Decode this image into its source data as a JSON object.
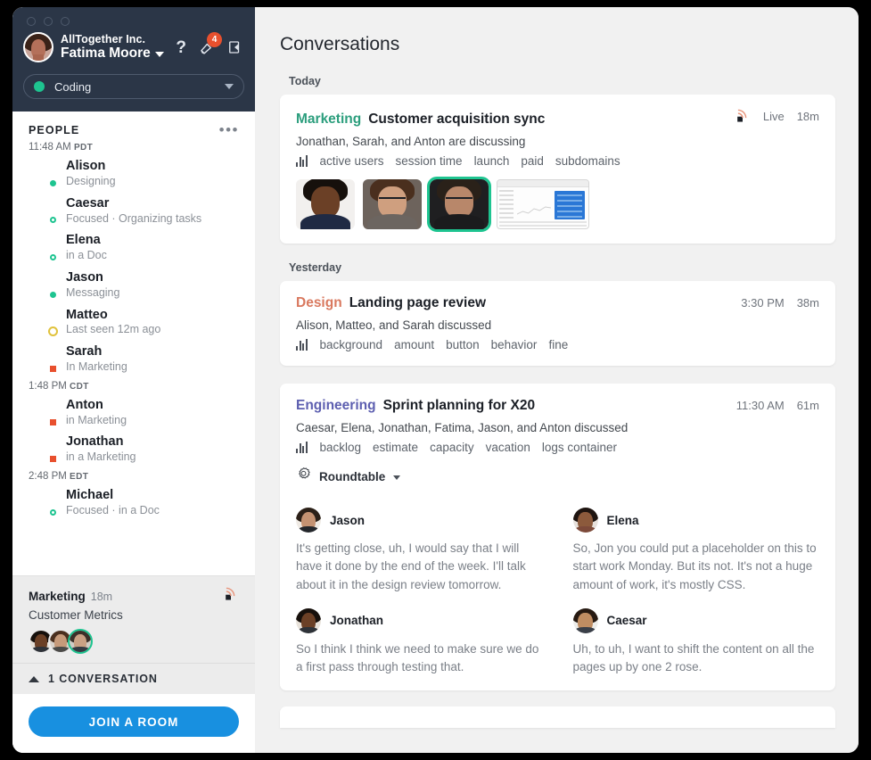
{
  "window": {
    "traffic_lights": 3
  },
  "sidebar": {
    "org": "AllTogether Inc.",
    "user": "Fatima Moore",
    "help_icon": "question-mark-icon",
    "notifications_icon": "bell-icon",
    "notifications_badge": "4",
    "leave_icon": "exit-icon",
    "status": {
      "label": "Coding",
      "dot_color": "#1ec490"
    },
    "people": {
      "title": "PEOPLE",
      "more_icon": "more-options-icon",
      "groups": [
        {
          "timezone_time": "11:48 AM",
          "timezone_code": "PDT",
          "members": [
            {
              "name": "Alison",
              "status": "Designing",
              "presence": "online",
              "hair": "#2a1a14",
              "skin": "#c18a6a",
              "body": "#2a4e8a",
              "bg": "#dfe8f0",
              "glasses": false
            },
            {
              "name": "Caesar",
              "status": "Focused · Organizing tasks",
              "presence": "focus",
              "hair": "#271a12",
              "skin": "#c08d62",
              "body": "#3a3f48",
              "bg": "#ededea",
              "glasses": true
            },
            {
              "name": "Elena",
              "status": "in a Doc",
              "presence": "focus",
              "hair": "#1e1410",
              "skin": "#8c5a3c",
              "body": "#7d4a3a",
              "bg": "#e7e1dc",
              "glasses": false
            },
            {
              "name": "Jason",
              "status": "Messaging",
              "presence": "online",
              "hair": "#2b2018",
              "skin": "#c49272",
              "body": "#23262b",
              "bg": "#ece7e2",
              "glasses": false
            },
            {
              "name": "Matteo",
              "status": "Last seen 12m ago",
              "presence": "away",
              "hair": "#4a372a",
              "skin": "#cfa183",
              "body": "#4c6a52",
              "bg": "#e0ded6",
              "glasses": true
            },
            {
              "name": "Sarah",
              "status": "In Marketing",
              "presence": "busy",
              "hair": "#6d4a33",
              "skin": "#d6aa8d",
              "body": "#cfcbc4",
              "bg": "#e6e2dd",
              "glasses": true
            }
          ]
        },
        {
          "timezone_time": "1:48 PM",
          "timezone_code": "CDT",
          "members": [
            {
              "name": "Anton",
              "status": "in Marketing",
              "presence": "busy",
              "hair": "#3b3029",
              "skin": "#c9a184",
              "body": "#343a42",
              "bg": "#d9d6cf",
              "glasses": true
            },
            {
              "name": "Jonathan",
              "status": "in a Marketing",
              "presence": "busy",
              "hair": "#16100c",
              "skin": "#6b4026",
              "body": "#2e3238",
              "bg": "#e8e2da",
              "glasses": false
            }
          ]
        },
        {
          "timezone_time": "2:48 PM",
          "timezone_code": "EDT",
          "members": [
            {
              "name": "Michael",
              "status": "Focused · in a Doc",
              "presence": "focus",
              "hair": "#3a2a20",
              "skin": "#c08b68",
              "body": "#2b2f36",
              "bg": "#dcd8d2",
              "glasses": true
            }
          ]
        }
      ]
    },
    "conversation_preview": {
      "team": "Marketing",
      "duration": "18m",
      "title": "Customer Metrics",
      "live_icon": "broadcast-icon",
      "avatars": [
        {
          "hair": "#16100c",
          "skin": "#6b4026",
          "body": "#2e3238",
          "bg": "#e4ded6",
          "selected": false
        },
        {
          "hair": "#4a2f1e",
          "skin": "#c69a7a",
          "body": "#4b4a48",
          "bg": "#d8d2cb",
          "selected": false
        },
        {
          "hair": "#3b3029",
          "skin": "#c9a184",
          "body": "#343a42",
          "bg": "#cfccc6",
          "selected": true
        }
      ]
    },
    "conversations_toggle": {
      "label": "1 CONVERSATION",
      "icon": "chevron-up-icon"
    },
    "join_button": "JOIN A ROOM"
  },
  "main": {
    "page_title": "Conversations",
    "sections": [
      {
        "day_label": "Today",
        "cards": [
          {
            "team": "Marketing",
            "team_color": "#2c9e7d",
            "title": "Customer acquisition sync",
            "live_icon": "broadcast-icon",
            "live_label": "Live",
            "duration": "18m",
            "participants": "Jonathan, Sarah, and Anton are discussing",
            "topics": [
              "active users",
              "session time",
              "launch",
              "paid",
              "subdomains"
            ],
            "tiles": [
              {
                "hair": "#16100c",
                "skin": "#6b4026",
                "body": "#1f2a44",
                "bg": "#f2f0ee",
                "glasses": false,
                "selected": false
              },
              {
                "hair": "#4a2f1e",
                "skin": "#cf9f7f",
                "body": "#6c6560",
                "bg": "#6d635c",
                "glasses": true,
                "selected": false
              },
              {
                "hair": "#2a2119",
                "skin": "#b8876a",
                "body": "#1b1b1d",
                "bg": "#1f1f21",
                "glasses": true,
                "selected": true
              }
            ],
            "screenshare": true
          }
        ]
      },
      {
        "day_label": "Yesterday",
        "cards": [
          {
            "team": "Design",
            "team_color": "#d9795f",
            "title": "Landing page review",
            "time": "3:30 PM",
            "duration": "38m",
            "participants": "Alison, Matteo, and Sarah discussed",
            "topics": [
              "background",
              "amount",
              "button",
              "behavior",
              "fine"
            ]
          },
          {
            "team": "Engineering",
            "team_color": "#5d5fb0",
            "title": "Sprint planning for X20",
            "time": "11:30 AM",
            "duration": "61m",
            "participants": "Caesar, Elena, Jonathan, Fatima, Jason, and Anton discussed",
            "topics": [
              "backlog",
              "estimate",
              "capacity",
              "vacation",
              "logs container"
            ],
            "roundtable": {
              "icon": "roundtable-icon",
              "label": "Roundtable",
              "chevron": "chevron-down-icon"
            },
            "quotes": [
              {
                "name": "Jason",
                "text": "It's getting close, uh, I would say that I will have it done by the end of the week.  I'll talk about it in the design review tomorrow.",
                "hair": "#2b2018",
                "skin": "#c49272",
                "body": "#23262b",
                "bg": "#efeae4"
              },
              {
                "name": "Elena",
                "text": "So, Jon you could put a placeholder on this to start work Monday.  But its not. It's not a huge amount of work, it's mostly CSS.",
                "hair": "#1e1410",
                "skin": "#8c5a3c",
                "body": "#7d4a3a",
                "bg": "#e7e1dc"
              },
              {
                "name": "Jonathan",
                "text": "So I think I think we need to make sure we do a first pass through testing that.",
                "hair": "#16100c",
                "skin": "#6b4026",
                "body": "#2e3238",
                "bg": "#e8e2da"
              },
              {
                "name": "Caesar",
                "text": "Uh, to uh, I want to shift the content on all the pages up by one 2 rose.",
                "hair": "#271a12",
                "skin": "#c08d62",
                "body": "#3a3f48",
                "bg": "#ededea"
              }
            ]
          }
        ]
      }
    ]
  }
}
